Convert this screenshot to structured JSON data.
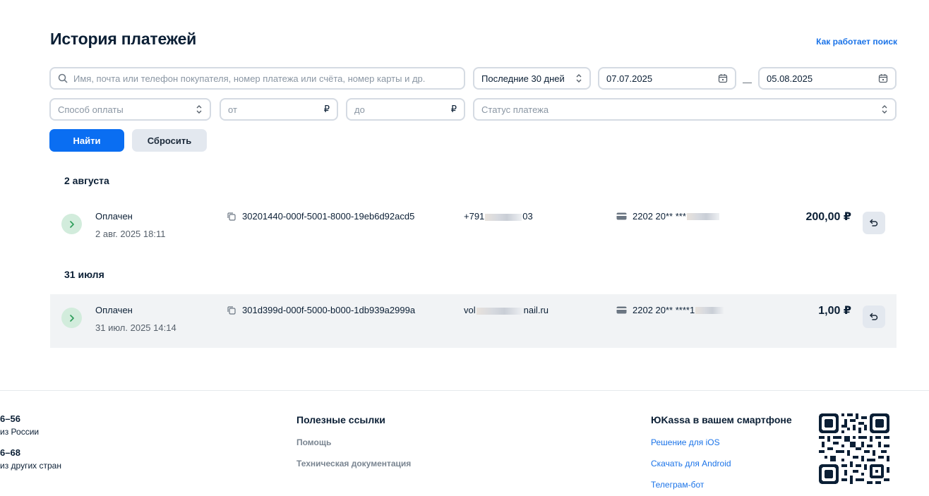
{
  "header": {
    "title": "История платежей",
    "help_link": "Как работает поиск"
  },
  "filters": {
    "search_placeholder": "Имя, почта или телефон покупателя, номер платежа или счёта, номер карты и др.",
    "period": "Последние 30 дней",
    "date_from": "07.07.2025",
    "date_separator": "—",
    "date_to": "05.08.2025",
    "payment_method_placeholder": "Способ оплаты",
    "amount_from_placeholder": "от",
    "amount_to_placeholder": "до",
    "currency_symbol": "₽",
    "status_placeholder": "Статус платежа",
    "find_label": "Найти",
    "reset_label": "Сбросить"
  },
  "groups": [
    {
      "date": "2 августа",
      "payments": [
        {
          "status": "Оплачен",
          "datetime": "2 авг. 2025 18:11",
          "id": "30201440-000f-5001-8000-19eb6d92acd5",
          "contact_start": "+791",
          "contact_end": "03",
          "card": "2202 20** ***",
          "amount": "200,00 ₽"
        }
      ]
    },
    {
      "date": "31 июля",
      "payments": [
        {
          "status": "Оплачен",
          "datetime": "31 июл. 2025 14:14",
          "id": "301d399d-000f-5000-b000-1db939a2999a",
          "contact_start": "vol",
          "contact_end": "nail.ru",
          "card": "2202 20** ****1",
          "amount": "1,00 ₽"
        }
      ]
    }
  ],
  "footer": {
    "phone1": "6–56",
    "phone1_note": "из России",
    "phone2": "6–68",
    "phone2_note": "из других стран",
    "useful_links_title": "Полезные ссылки",
    "useful_links": [
      "Помощь",
      "Техническая документация"
    ],
    "mobile_title": "ЮKassa в вашем смартфоне",
    "mobile_links": [
      "Решение для iOS",
      "Скачать для Android",
      "Телеграм-бот"
    ]
  },
  "colors": {
    "accent": "#0a6ef2",
    "link": "#1a73e8",
    "status_paid_bg": "#d2ecdc",
    "status_paid_icon": "#2e9e5b"
  }
}
